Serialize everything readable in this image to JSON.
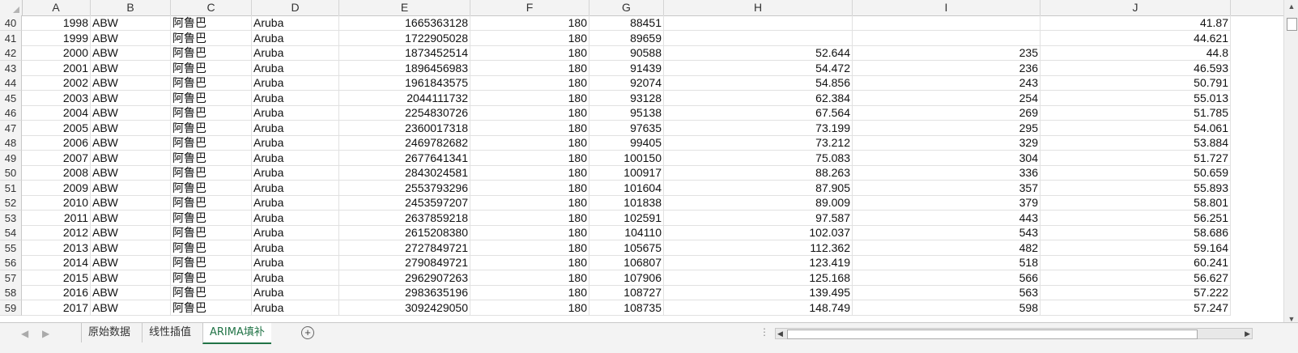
{
  "columns": [
    "A",
    "B",
    "C",
    "D",
    "E",
    "F",
    "G",
    "H",
    "I",
    "J"
  ],
  "rows": [
    {
      "n": "40",
      "a": "1998",
      "b": "ABW",
      "c": "阿鲁巴",
      "d": "Aruba",
      "e": "1665363128",
      "f": "180",
      "g": "88451",
      "h": "",
      "i": "",
      "j": "41.87"
    },
    {
      "n": "41",
      "a": "1999",
      "b": "ABW",
      "c": "阿鲁巴",
      "d": "Aruba",
      "e": "1722905028",
      "f": "180",
      "g": "89659",
      "h": "",
      "i": "",
      "j": "44.621"
    },
    {
      "n": "42",
      "a": "2000",
      "b": "ABW",
      "c": "阿鲁巴",
      "d": "Aruba",
      "e": "1873452514",
      "f": "180",
      "g": "90588",
      "h": "52.644",
      "i": "235",
      "j": "44.8"
    },
    {
      "n": "43",
      "a": "2001",
      "b": "ABW",
      "c": "阿鲁巴",
      "d": "Aruba",
      "e": "1896456983",
      "f": "180",
      "g": "91439",
      "h": "54.472",
      "i": "236",
      "j": "46.593"
    },
    {
      "n": "44",
      "a": "2002",
      "b": "ABW",
      "c": "阿鲁巴",
      "d": "Aruba",
      "e": "1961843575",
      "f": "180",
      "g": "92074",
      "h": "54.856",
      "i": "243",
      "j": "50.791"
    },
    {
      "n": "45",
      "a": "2003",
      "b": "ABW",
      "c": "阿鲁巴",
      "d": "Aruba",
      "e": "2044111732",
      "f": "180",
      "g": "93128",
      "h": "62.384",
      "i": "254",
      "j": "55.013"
    },
    {
      "n": "46",
      "a": "2004",
      "b": "ABW",
      "c": "阿鲁巴",
      "d": "Aruba",
      "e": "2254830726",
      "f": "180",
      "g": "95138",
      "h": "67.564",
      "i": "269",
      "j": "51.785"
    },
    {
      "n": "47",
      "a": "2005",
      "b": "ABW",
      "c": "阿鲁巴",
      "d": "Aruba",
      "e": "2360017318",
      "f": "180",
      "g": "97635",
      "h": "73.199",
      "i": "295",
      "j": "54.061"
    },
    {
      "n": "48",
      "a": "2006",
      "b": "ABW",
      "c": "阿鲁巴",
      "d": "Aruba",
      "e": "2469782682",
      "f": "180",
      "g": "99405",
      "h": "73.212",
      "i": "329",
      "j": "53.884"
    },
    {
      "n": "49",
      "a": "2007",
      "b": "ABW",
      "c": "阿鲁巴",
      "d": "Aruba",
      "e": "2677641341",
      "f": "180",
      "g": "100150",
      "h": "75.083",
      "i": "304",
      "j": "51.727"
    },
    {
      "n": "50",
      "a": "2008",
      "b": "ABW",
      "c": "阿鲁巴",
      "d": "Aruba",
      "e": "2843024581",
      "f": "180",
      "g": "100917",
      "h": "88.263",
      "i": "336",
      "j": "50.659"
    },
    {
      "n": "51",
      "a": "2009",
      "b": "ABW",
      "c": "阿鲁巴",
      "d": "Aruba",
      "e": "2553793296",
      "f": "180",
      "g": "101604",
      "h": "87.905",
      "i": "357",
      "j": "55.893"
    },
    {
      "n": "52",
      "a": "2010",
      "b": "ABW",
      "c": "阿鲁巴",
      "d": "Aruba",
      "e": "2453597207",
      "f": "180",
      "g": "101838",
      "h": "89.009",
      "i": "379",
      "j": "58.801"
    },
    {
      "n": "53",
      "a": "2011",
      "b": "ABW",
      "c": "阿鲁巴",
      "d": "Aruba",
      "e": "2637859218",
      "f": "180",
      "g": "102591",
      "h": "97.587",
      "i": "443",
      "j": "56.251"
    },
    {
      "n": "54",
      "a": "2012",
      "b": "ABW",
      "c": "阿鲁巴",
      "d": "Aruba",
      "e": "2615208380",
      "f": "180",
      "g": "104110",
      "h": "102.037",
      "i": "543",
      "j": "58.686"
    },
    {
      "n": "55",
      "a": "2013",
      "b": "ABW",
      "c": "阿鲁巴",
      "d": "Aruba",
      "e": "2727849721",
      "f": "180",
      "g": "105675",
      "h": "112.362",
      "i": "482",
      "j": "59.164"
    },
    {
      "n": "56",
      "a": "2014",
      "b": "ABW",
      "c": "阿鲁巴",
      "d": "Aruba",
      "e": "2790849721",
      "f": "180",
      "g": "106807",
      "h": "123.419",
      "i": "518",
      "j": "60.241"
    },
    {
      "n": "57",
      "a": "2015",
      "b": "ABW",
      "c": "阿鲁巴",
      "d": "Aruba",
      "e": "2962907263",
      "f": "180",
      "g": "107906",
      "h": "125.168",
      "i": "566",
      "j": "56.627"
    },
    {
      "n": "58",
      "a": "2016",
      "b": "ABW",
      "c": "阿鲁巴",
      "d": "Aruba",
      "e": "2983635196",
      "f": "180",
      "g": "108727",
      "h": "139.495",
      "i": "563",
      "j": "57.222"
    },
    {
      "n": "59",
      "a": "2017",
      "b": "ABW",
      "c": "阿鲁巴",
      "d": "Aruba",
      "e": "3092429050",
      "f": "180",
      "g": "108735",
      "h": "148.749",
      "i": "598",
      "j": "57.247"
    }
  ],
  "sheet_tabs": [
    {
      "label": "原始数据",
      "active": false
    },
    {
      "label": "线性插值",
      "active": false
    },
    {
      "label": "ARIMA填补",
      "active": true
    }
  ],
  "add_sheet_icon": "plus-circle-icon",
  "colors": {
    "accent": "#217346",
    "header_bg": "#f3f3f3",
    "grid": "#e1e1e1"
  }
}
